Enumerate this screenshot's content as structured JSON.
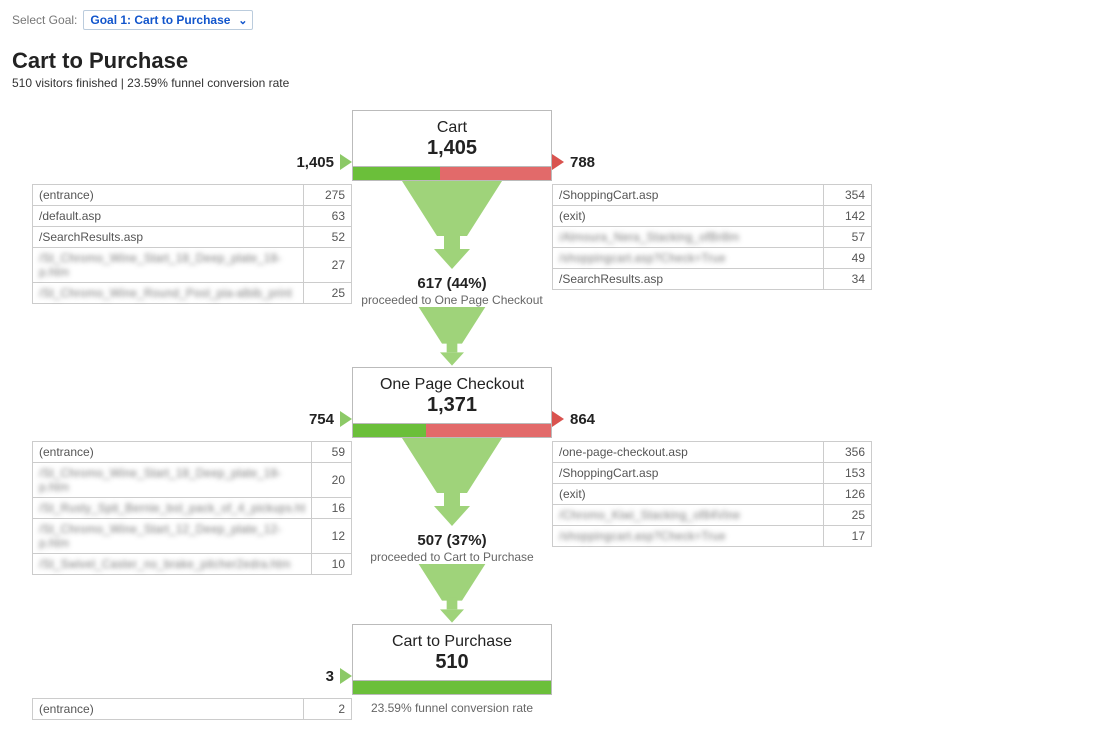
{
  "selector": {
    "label": "Select Goal:",
    "value": "Goal 1: Cart to Purchase"
  },
  "header": {
    "title": "Cart to Purchase",
    "subtitle": "510 visitors finished | 23.59% funnel conversion rate"
  },
  "steps": [
    {
      "name": "Cart",
      "count": "1,405",
      "in_count": "1,405",
      "out_count": "788",
      "bar_green_pct": 44,
      "proceed_count": "617",
      "proceed_pct": "(44%)",
      "proceed_label": "proceeded to One Page Checkout",
      "sources": [
        {
          "path": "(entrance)",
          "n": "275"
        },
        {
          "path": "/default.asp",
          "n": "63"
        },
        {
          "path": "/SearchResults.asp",
          "n": "52"
        },
        {
          "path": "/St_Chromo_Wine_Start_18_Deep_plate_18-p.htm",
          "n": "27",
          "blur": true
        },
        {
          "path": "/St_Chromo_Wine_Round_Pool_pia-albib_print",
          "n": "25",
          "blur": true
        }
      ],
      "exits": [
        {
          "path": "/ShoppingCart.asp",
          "n": "354"
        },
        {
          "path": "(exit)",
          "n": "142"
        },
        {
          "path": "/Almoura_Nera_Stacking_ofBrillm",
          "n": "57",
          "blur": true
        },
        {
          "path": "/shoppingcart.asp?Check=True",
          "n": "49",
          "blur": true
        },
        {
          "path": "/SearchResults.asp",
          "n": "34"
        }
      ]
    },
    {
      "name": "One Page Checkout",
      "count": "1,371",
      "in_count": "754",
      "out_count": "864",
      "bar_green_pct": 37,
      "proceed_count": "507",
      "proceed_pct": "(37%)",
      "proceed_label": "proceeded to Cart to Purchase",
      "sources": [
        {
          "path": "(entrance)",
          "n": "59"
        },
        {
          "path": "/St_Chromo_Wine_Start_18_Deep_plate_18-p.htm",
          "n": "20",
          "blur": true
        },
        {
          "path": "/St_Rusty_Spit_Bernie_bol_pack_of_4_pickups.ht",
          "n": "16",
          "blur": true
        },
        {
          "path": "/St_Chromo_Wine_Start_12_Deep_plate_12-p.htm",
          "n": "12",
          "blur": true
        },
        {
          "path": "/St_Swivel_Caster_no_brake_pitcher2edra.htm",
          "n": "10",
          "blur": true
        }
      ],
      "exits": [
        {
          "path": "/one-page-checkout.asp",
          "n": "356"
        },
        {
          "path": "/ShoppingCart.asp",
          "n": "153"
        },
        {
          "path": "(exit)",
          "n": "126"
        },
        {
          "path": "/Chromo_Kiwi_Stacking_of84Vine",
          "n": "25",
          "blur": true
        },
        {
          "path": "/shoppingcart.asp?Check=True",
          "n": "17",
          "blur": true
        }
      ]
    },
    {
      "name": "Cart to Purchase",
      "count": "510",
      "in_count": "3",
      "out_count": "",
      "bar_green_pct": 100,
      "conversion_label": "23.59% funnel conversion rate",
      "sources": [
        {
          "path": "(entrance)",
          "n": "2"
        }
      ],
      "exits": []
    }
  ]
}
